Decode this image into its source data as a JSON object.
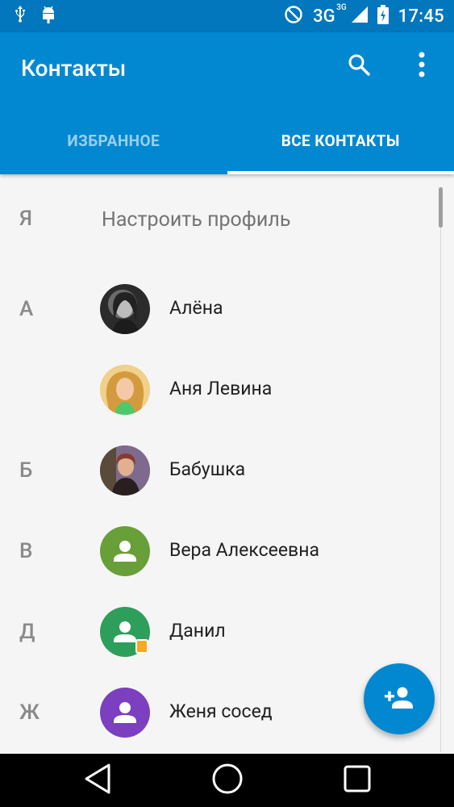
{
  "status_bar": {
    "network": "3G",
    "network_sup": "3G",
    "time": "17:45",
    "icons": [
      "usb-icon",
      "android-debug-icon",
      "do-not-disturb-icon",
      "signal-icon",
      "battery-charging-icon"
    ]
  },
  "app_bar": {
    "title": "Контакты",
    "actions": [
      "search-icon",
      "more-vert-icon"
    ]
  },
  "tabs": [
    {
      "label": "ИЗБРАННОЕ",
      "active": false
    },
    {
      "label": "ВСЕ КОНТАКТЫ",
      "active": true
    }
  ],
  "profile": {
    "letter": "Я",
    "label": "Настроить профиль"
  },
  "contacts": [
    {
      "letter": "А",
      "name": "Алёна",
      "avatar": "photo",
      "avatar_color": "#4a4a4a"
    },
    {
      "letter": "",
      "name": "Аня Левина",
      "avatar": "photo",
      "avatar_color": "#d7a86e"
    },
    {
      "letter": "Б",
      "name": "Бабушка",
      "avatar": "photo",
      "avatar_color": "#8d6e63"
    },
    {
      "letter": "В",
      "name": "Вера Алексеевна",
      "avatar": "person-icon",
      "avatar_color": "#689f38"
    },
    {
      "letter": "Д",
      "name": "Данил",
      "avatar": "person-icon",
      "avatar_color": "#2e9e5b"
    },
    {
      "letter": "Ж",
      "name": "Женя сосед",
      "avatar": "person-icon",
      "avatar_color": "#7b3fbf"
    }
  ],
  "fab": {
    "icon": "add-person-icon",
    "color": "#0288d1"
  },
  "nav_bar": {
    "buttons": [
      "back-icon",
      "home-icon",
      "recents-icon"
    ]
  },
  "colors": {
    "primary": "#0288d1",
    "primary_dark": "#0277bd",
    "background": "#f5f5f5"
  }
}
